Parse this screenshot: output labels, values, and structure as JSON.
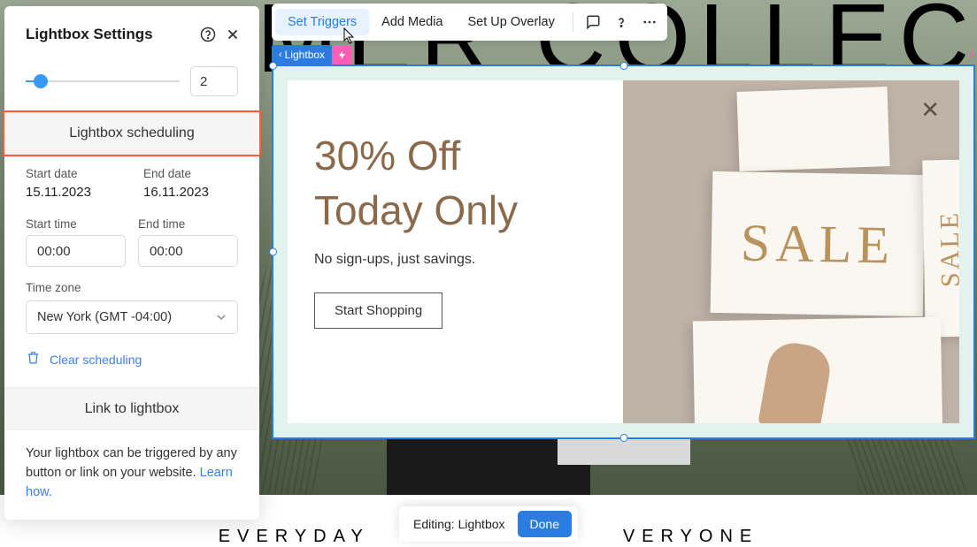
{
  "settings": {
    "title": "Lightbox Settings",
    "slider_value": "2",
    "scheduling": {
      "header": "Lightbox scheduling",
      "start_date_label": "Start date",
      "start_date": "15.11.2023",
      "end_date_label": "End date",
      "end_date": "16.11.2023",
      "start_time_label": "Start time",
      "start_time": "00:00",
      "end_time_label": "End time",
      "end_time": "00:00",
      "timezone_label": "Time zone",
      "timezone_value": "New York (GMT -04:00)",
      "clear": "Clear scheduling"
    },
    "link": {
      "header": "Link to lightbox",
      "body": "Your lightbox can be triggered by any button or link on your website.",
      "learn": "Learn how."
    }
  },
  "toolbar": {
    "tab_triggers": "Set Triggers",
    "tab_media": "Add Media",
    "tab_overlay": "Set Up Overlay"
  },
  "selection": {
    "tag_label": "Lightbox"
  },
  "popup": {
    "headline1": "30% Off",
    "headline2": "Today Only",
    "sub": "No sign-ups, just savings.",
    "cta": "Start Shopping",
    "sale_word": "SALE"
  },
  "hero": {
    "line1a": "MER",
    "line1b": " COLLECT",
    "below": "EVERYDAY",
    "below2": "VERYONE"
  },
  "edit_bar": {
    "label": "Editing: Lightbox",
    "done": "Done"
  }
}
